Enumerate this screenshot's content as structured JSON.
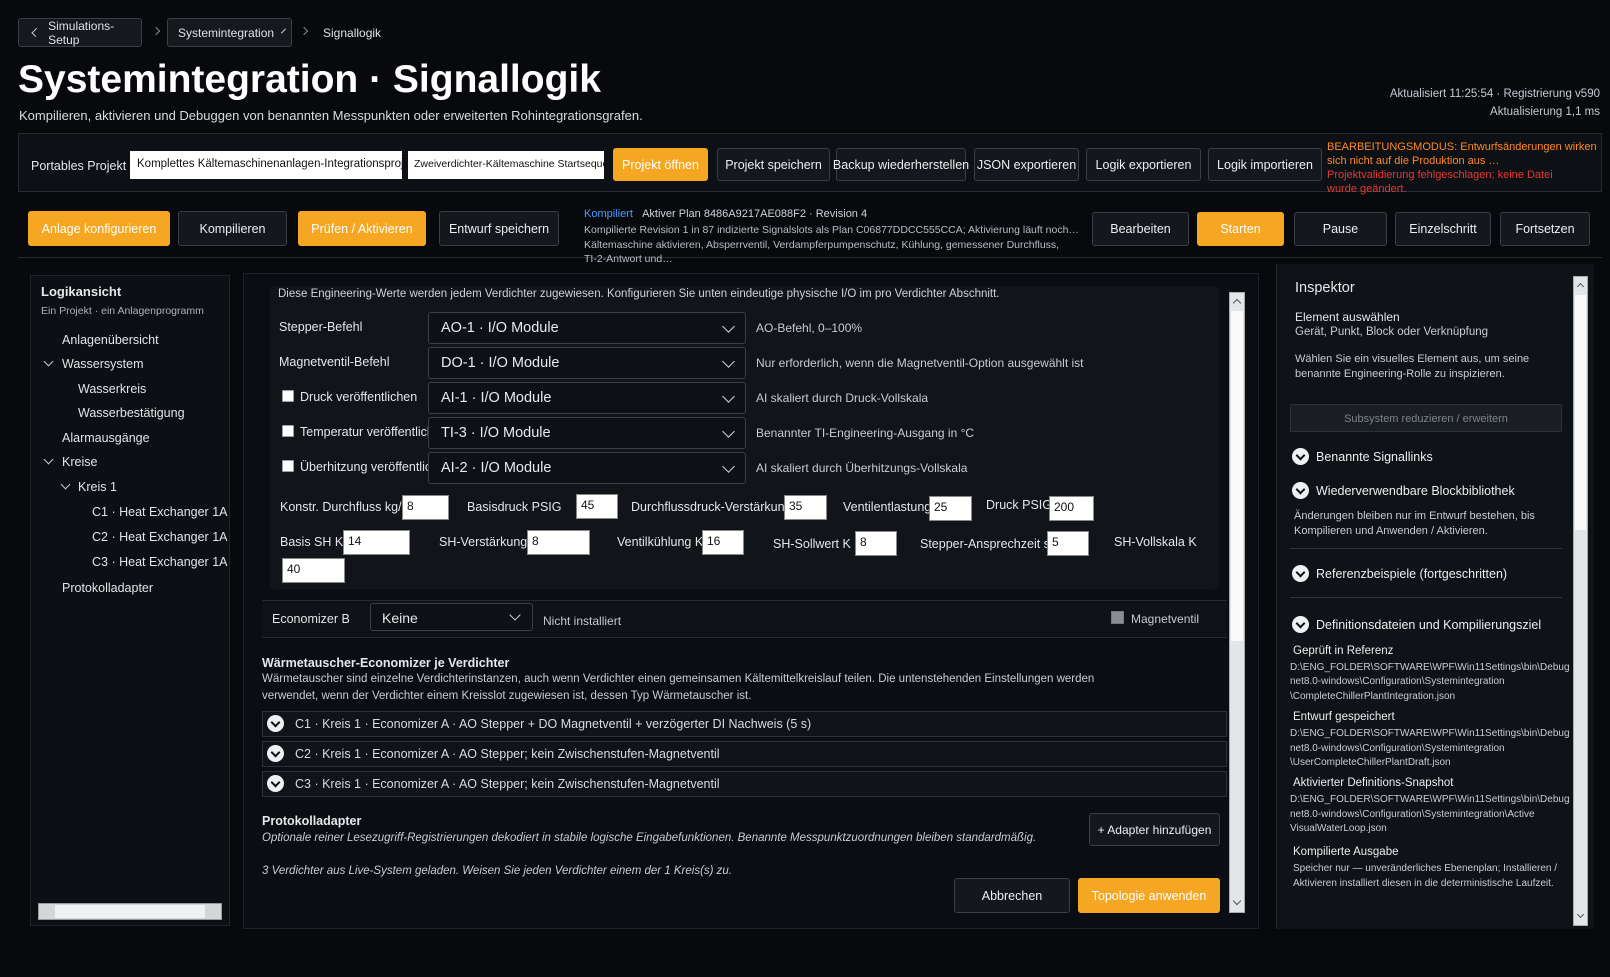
{
  "breadcrumb": {
    "back": "Simulations-Setup",
    "middle": "Systemintegration",
    "current": "Signallogik"
  },
  "header": {
    "title": "Systemintegration · Signallogik",
    "subtitle": "Kompilieren, aktivieren und Debuggen von benannten Messpunkten oder erweiterten Rohintegrationsgrafen.",
    "status1": "Aktualisiert 11:25:54 · Registrierung v590",
    "status2": "Aktualisierung 1,1 ms"
  },
  "project": {
    "label": "Portables Projekt",
    "name_value": "Komplettes Kältemaschinenanlagen-Integrationsprojekt",
    "seq_value": "Zweiverdichter-Kältemaschine Startsequenz, n",
    "open": "Projekt öffnen",
    "save": "Projekt speichern",
    "backup": "Backup wiederherstellen",
    "json": "JSON exportieren",
    "export": "Logik exportieren",
    "import": "Logik importieren",
    "warn1": "BEARBEITUNGSMODUS: Entwurfsänderungen wirken sich nicht auf die Produktion aus …",
    "warn2": "Projektvalidierung fehlgeschlagen; keine Datei wurde geändert."
  },
  "actions": {
    "configure": "Anlage konfigurieren",
    "compile": "Kompilieren",
    "check": "Prüfen / Aktivieren",
    "draft": "Entwurf speichern",
    "compiled": "Kompiliert",
    "plan": "Aktiver Plan 8486A9217AE088F2 · Revision 4",
    "log1": "Kompilierte Revision 1 in 87 indizierte Signalslots als Plan C06877DDCC555CCA; Aktivierung läuft noch…",
    "log2": "Kältemaschine aktivieren, Absperrventil, Verdampferpumpenschutz, Kühlung, gemessener Durchfluss,",
    "log3": "TI-2-Antwort und…",
    "edit": "Bearbeiten",
    "start": "Starten",
    "pause": "Pause",
    "step": "Einzelschritt",
    "resume": "Fortsetzen"
  },
  "sidebar": {
    "title": "Logikansicht",
    "subtitle": "Ein Projekt · ein Anlagenprogramm",
    "items": [
      "Anlagenübersicht",
      "Wassersystem",
      "Wasserkreis",
      "Wasserbestätigung",
      "Alarmausgänge",
      "Kreise",
      "Kreis 1",
      "C1 · Heat Exchanger 1A",
      "C2 · Heat Exchanger 1A",
      "C3 · Heat Exchanger 1A",
      "Protokolladapter"
    ]
  },
  "main": {
    "intro": "Diese Engineering-Werte werden jedem Verdichter zugewiesen. Konfigurieren Sie unten eindeutige physische I/O im pro Verdichter Abschnitt.",
    "rows": [
      {
        "label": "Stepper-Befehl",
        "select": "AO-1 · I/O Module",
        "note": "AO-Befehl, 0–100%"
      },
      {
        "label": "Magnetventil-Befehl",
        "select": "DO-1 · I/O Module",
        "note": "Nur erforderlich, wenn die Magnetventil-Option ausgewählt ist"
      },
      {
        "label": "Druck veröffentlichen",
        "select": "AI-1 · I/O Module",
        "note": "AI skaliert durch Druck-Vollskala"
      },
      {
        "label": "Temperatur veröffentlichen",
        "select": "TI-3 · I/O Module",
        "note": "Benannter TI-Engineering-Ausgang in °C"
      },
      {
        "label": "Überhitzung veröffentlichen",
        "select": "AI-2 · I/O Module",
        "note": "AI skaliert durch Überhitzungs-Vollskala"
      }
    ],
    "params": [
      {
        "label": "Konstr. Durchfluss kg/s",
        "value": "8"
      },
      {
        "label": "Basisdruck PSIG",
        "value": "45"
      },
      {
        "label": "Durchflussdruck-Verstärkung",
        "value": "35"
      },
      {
        "label": "Ventilentlastung",
        "value": "25"
      },
      {
        "label": "Druck PSIG",
        "value": "200"
      },
      {
        "label": "Basis SH K",
        "value": "14"
      },
      {
        "label": "SH-Verstärkung",
        "value": "8"
      },
      {
        "label": "Ventilkühlung K",
        "value": "16"
      },
      {
        "label": "SH-Sollwert K",
        "value": "8"
      },
      {
        "label": "Stepper-Ansprechzeit s",
        "value": "5"
      },
      {
        "label": "SH-Vollskala K",
        "value": "40"
      }
    ],
    "econ": {
      "label": "Economizer B",
      "select": "Keine",
      "note": "Nicht installiert",
      "valve": "Magnetventil"
    },
    "hx": {
      "title": "Wärmetauscher-Economizer je Verdichter",
      "desc1": "Wärmetauscher sind einzelne Verdichterinstanzen, auch wenn Verdichter einen gemeinsamen Kältemittelkreislauf teilen. Die untenstehenden Einstellungen werden",
      "desc2": "verwendet, wenn der Verdichter einem Kreisslot zugewiesen ist, dessen Typ Wärmetauscher ist.",
      "items": [
        "C1 · Kreis 1 · Economizer A · AO Stepper + DO Magnetventil + verzögerter DI Nachweis (5 s)",
        "C2 · Kreis 1 · Economizer A · AO Stepper; kein Zwischenstufen-Magnetventil",
        "C3 · Kreis 1 · Economizer A · AO Stepper; kein Zwischenstufen-Magnetventil"
      ]
    },
    "proto": {
      "title": "Protokolladapter",
      "desc": "Optionale reiner Lesezugriff-Registrierungen dekodiert in stabile logische Eingabefunktionen. Benannte Messpunktzuordnungen bleiben standardmäßig.",
      "add": "+ Adapter hinzufügen"
    },
    "footer_note": "3 Verdichter aus Live-System geladen. Weisen Sie jeden Verdichter einem der 1 Kreis(s) zu.",
    "cancel": "Abbrechen",
    "apply": "Topologie anwenden"
  },
  "inspector": {
    "title": "Inspektor",
    "select_title": "Element auswählen",
    "select_sub": "Gerät, Punkt, Block oder Verknüpfung",
    "select_desc": "Wählen Sie ein visuelles Element aus, um seine benannte Engineering-Rolle zu inspizieren.",
    "collapse": "Subsystem reduzieren / erweitern",
    "sec1": "Benannte Signallinks",
    "sec2": "Wiederverwendbare Blockbibliothek",
    "sec2_desc": "Änderungen bleiben nur im Entwurf bestehen, bis Kompilieren und Anwenden / Aktivieren.",
    "sec3": "Referenzbeispiele (fortgeschritten)",
    "sec4": "Definitionsdateien und Kompilierungsziel",
    "files": [
      {
        "title": "Geprüft in Referenz",
        "lines": [
          "D:\\ENG_FOLDER\\SOFTWARE\\WPF\\Win11Settings\\bin\\Debug",
          "net8.0-windows\\Configuration\\Systemintegration",
          "\\CompleteChillerPlantIntegration.json"
        ]
      },
      {
        "title": "Entwurf gespeichert",
        "lines": [
          "D:\\ENG_FOLDER\\SOFTWARE\\WPF\\Win11Settings\\bin\\Debug",
          "net8.0-windows\\Configuration\\Systemintegration",
          "\\UserCompleteChillerPlantDraft.json"
        ]
      },
      {
        "title": "Aktivierter Definitions-Snapshot",
        "lines": [
          "D:\\ENG_FOLDER\\SOFTWARE\\WPF\\Win11Settings\\bin\\Debug",
          "net8.0-windows\\Configuration\\Systemintegration\\Active",
          "VisualWaterLoop.json"
        ]
      }
    ],
    "compiled_title": "Kompilierte Ausgabe",
    "compiled_desc": "Speicher nur — unveränderliches Ebenenplan; Installieren / Aktivieren installiert diesen in die deterministische Laufzeit."
  },
  "colors": {
    "accent": "#f5a623",
    "warn": "#ff8a1f",
    "error": "#e53935",
    "link": "#4a9eff"
  }
}
